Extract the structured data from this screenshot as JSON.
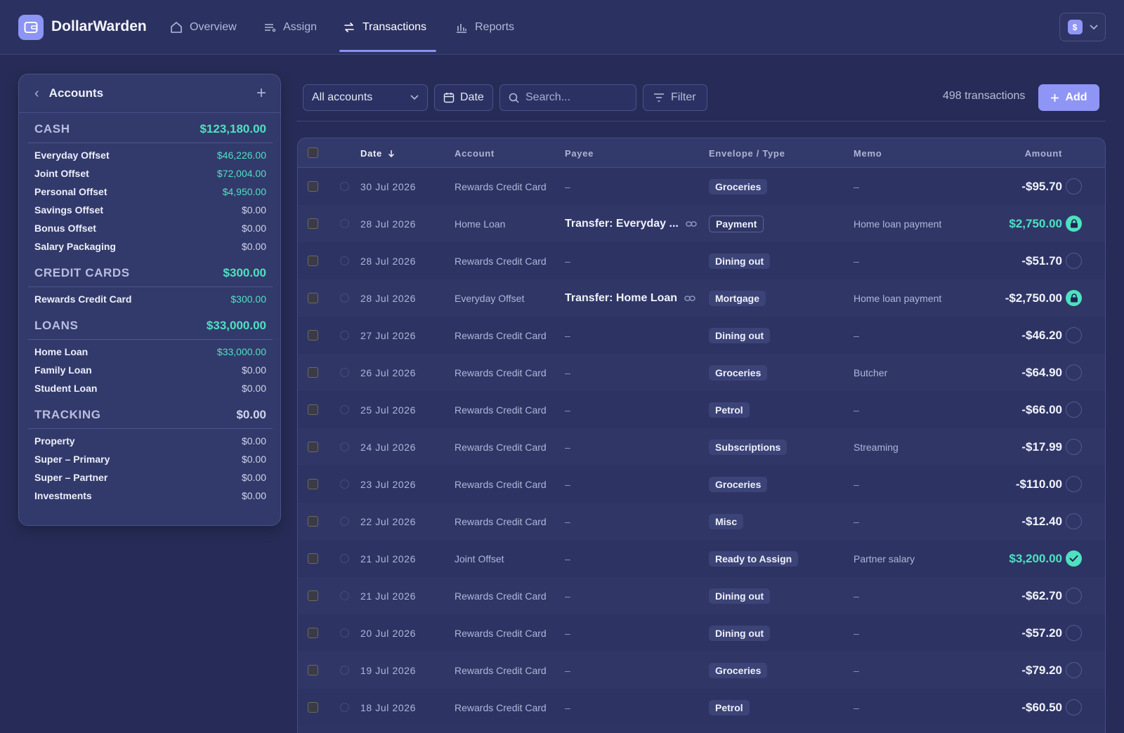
{
  "app": {
    "name": "DollarWarden"
  },
  "nav": {
    "items": [
      {
        "label": "Overview",
        "icon": "home-icon"
      },
      {
        "label": "Assign",
        "icon": "list-icon"
      },
      {
        "label": "Transactions",
        "icon": "swap-icon",
        "active": true
      },
      {
        "label": "Reports",
        "icon": "bar-chart-icon"
      }
    ],
    "user_badge": "$"
  },
  "accounts": {
    "title": "Accounts",
    "groups": [
      {
        "name": "CASH",
        "total": "$123,180.00",
        "accounts": [
          {
            "name": "Everyday Offset",
            "balance": "$46,226.00"
          },
          {
            "name": "Joint Offset",
            "balance": "$72,004.00"
          },
          {
            "name": "Personal Offset",
            "balance": "$4,950.00"
          },
          {
            "name": "Savings Offset",
            "balance": "$0.00"
          },
          {
            "name": "Bonus Offset",
            "balance": "$0.00"
          },
          {
            "name": "Salary Packaging",
            "balance": "$0.00"
          }
        ]
      },
      {
        "name": "CREDIT CARDS",
        "total": "$300.00",
        "accounts": [
          {
            "name": "Rewards Credit Card",
            "balance": "$300.00"
          }
        ]
      },
      {
        "name": "LOANS",
        "total": "$33,000.00",
        "accounts": [
          {
            "name": "Home Loan",
            "balance": "$33,000.00"
          },
          {
            "name": "Family Loan",
            "balance": "$0.00"
          },
          {
            "name": "Student Loan",
            "balance": "$0.00"
          }
        ]
      },
      {
        "name": "TRACKING",
        "total": "$0.00",
        "accounts": [
          {
            "name": "Property",
            "balance": "$0.00"
          },
          {
            "name": "Super – Primary",
            "balance": "$0.00"
          },
          {
            "name": "Super – Partner",
            "balance": "$0.00"
          },
          {
            "name": "Investments",
            "balance": "$0.00"
          }
        ]
      }
    ]
  },
  "toolbar": {
    "account_filter": "All accounts",
    "date_label": "Date",
    "search_placeholder": "Search...",
    "filter_label": "Filter",
    "count": "498 transactions",
    "add_label": "Add"
  },
  "table": {
    "headers": {
      "date": "Date",
      "account": "Account",
      "payee": "Payee",
      "envelope": "Envelope / Type",
      "memo": "Memo",
      "amount": "Amount"
    },
    "rows": [
      {
        "date": "30 Jul 2026",
        "account": "Rewards Credit Card",
        "payee": "–",
        "envelope": "Groceries",
        "memo": "–",
        "amount": "-$95.70",
        "status": "open"
      },
      {
        "date": "28 Jul 2026",
        "account": "Home Loan",
        "payee": "Transfer: Everyday ...",
        "envelope": "Payment",
        "memo": "Home loan payment",
        "amount": "$2,750.00",
        "status": "locked",
        "transfer": true,
        "outline": true,
        "positive": true
      },
      {
        "date": "28 Jul 2026",
        "account": "Rewards Credit Card",
        "payee": "–",
        "envelope": "Dining out",
        "memo": "–",
        "amount": "-$51.70",
        "status": "open"
      },
      {
        "date": "28 Jul 2026",
        "account": "Everyday Offset",
        "payee": "Transfer: Home Loan",
        "envelope": "Mortgage",
        "memo": "Home loan payment",
        "amount": "-$2,750.00",
        "status": "locked",
        "transfer": true
      },
      {
        "date": "27 Jul 2026",
        "account": "Rewards Credit Card",
        "payee": "–",
        "envelope": "Dining out",
        "memo": "–",
        "amount": "-$46.20",
        "status": "open"
      },
      {
        "date": "26 Jul 2026",
        "account": "Rewards Credit Card",
        "payee": "–",
        "envelope": "Groceries",
        "memo": "Butcher",
        "amount": "-$64.90",
        "status": "open"
      },
      {
        "date": "25 Jul 2026",
        "account": "Rewards Credit Card",
        "payee": "–",
        "envelope": "Petrol",
        "memo": "–",
        "amount": "-$66.00",
        "status": "open"
      },
      {
        "date": "24 Jul 2026",
        "account": "Rewards Credit Card",
        "payee": "–",
        "envelope": "Subscriptions",
        "memo": "Streaming",
        "amount": "-$17.99",
        "status": "open"
      },
      {
        "date": "23 Jul 2026",
        "account": "Rewards Credit Card",
        "payee": "–",
        "envelope": "Groceries",
        "memo": "–",
        "amount": "-$110.00",
        "status": "open"
      },
      {
        "date": "22 Jul 2026",
        "account": "Rewards Credit Card",
        "payee": "–",
        "envelope": "Misc",
        "memo": "–",
        "amount": "-$12.40",
        "status": "open"
      },
      {
        "date": "21 Jul 2026",
        "account": "Joint Offset",
        "payee": "–",
        "envelope": "Ready to Assign",
        "memo": "Partner salary",
        "amount": "$3,200.00",
        "status": "ok",
        "positive": true
      },
      {
        "date": "21 Jul 2026",
        "account": "Rewards Credit Card",
        "payee": "–",
        "envelope": "Dining out",
        "memo": "–",
        "amount": "-$62.70",
        "status": "open"
      },
      {
        "date": "20 Jul 2026",
        "account": "Rewards Credit Card",
        "payee": "–",
        "envelope": "Dining out",
        "memo": "–",
        "amount": "-$57.20",
        "status": "open"
      },
      {
        "date": "19 Jul 2026",
        "account": "Rewards Credit Card",
        "payee": "–",
        "envelope": "Groceries",
        "memo": "–",
        "amount": "-$79.20",
        "status": "open"
      },
      {
        "date": "18 Jul 2026",
        "account": "Rewards Credit Card",
        "payee": "–",
        "envelope": "Petrol",
        "memo": "–",
        "amount": "-$60.50",
        "status": "open"
      }
    ]
  },
  "colors": {
    "accent": "#8e95f5",
    "positive": "#4fe0c0",
    "background": "#262c57"
  }
}
